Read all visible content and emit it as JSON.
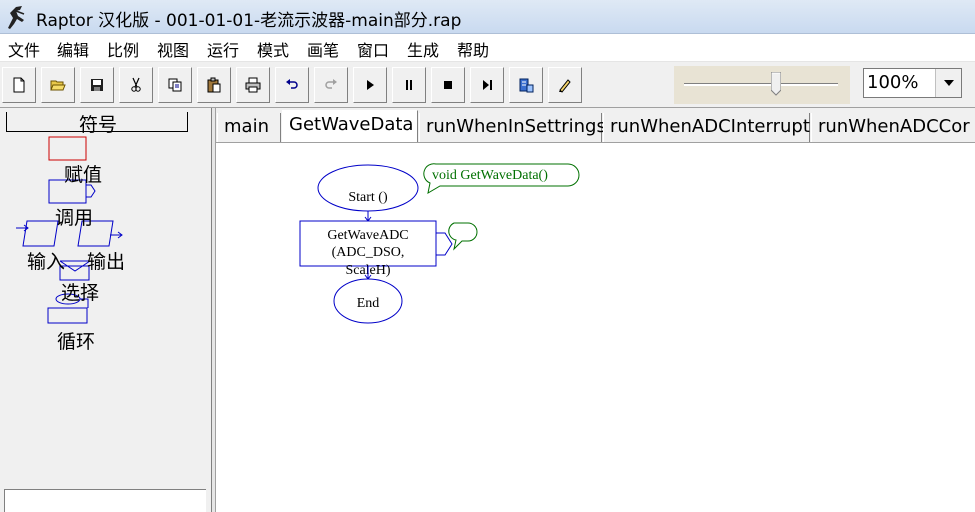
{
  "window": {
    "title": "Raptor 汉化版 - 001-01-01-老流示波器-main部分.rap",
    "app_icon": "raptor-icon"
  },
  "menu": {
    "items": [
      "文件",
      "编辑",
      "比例",
      "视图",
      "运行",
      "模式",
      "画笔",
      "窗口",
      "生成",
      "帮助"
    ]
  },
  "toolbar": {
    "buttons": [
      "new-file-icon",
      "open-folder-icon",
      "save-icon",
      "cut-icon",
      "copy-icon",
      "paste-icon",
      "print-icon",
      "undo-icon",
      "redo-icon",
      "play-icon",
      "pause-icon",
      "stop-icon",
      "step-icon",
      "test-server-icon",
      "pen-icon"
    ],
    "zoom_value": "100%",
    "zoom_slider_fraction": 0.6
  },
  "symbols": {
    "title": "符号",
    "assignment": "赋值",
    "call": "调用",
    "input": "输入",
    "output": "输出",
    "selection": "选择",
    "loop": "循环"
  },
  "tabs": {
    "items": [
      "main",
      "GetWaveData",
      "runWhenInSettrings",
      "runWhenADCInterrupt",
      "runWhenADCCor"
    ],
    "active": "GetWaveData"
  },
  "flowchart": {
    "start_label": "Start ()",
    "comment_label": "void GetWaveData()",
    "call_line1": "GetWaveADC",
    "call_line2": "(ADC_DSO,",
    "call_line3": "ScaleH)",
    "end_label": "End",
    "colors": {
      "shape": "#0000c8",
      "comment": "#007000",
      "selection_box": "#cc0000"
    }
  }
}
